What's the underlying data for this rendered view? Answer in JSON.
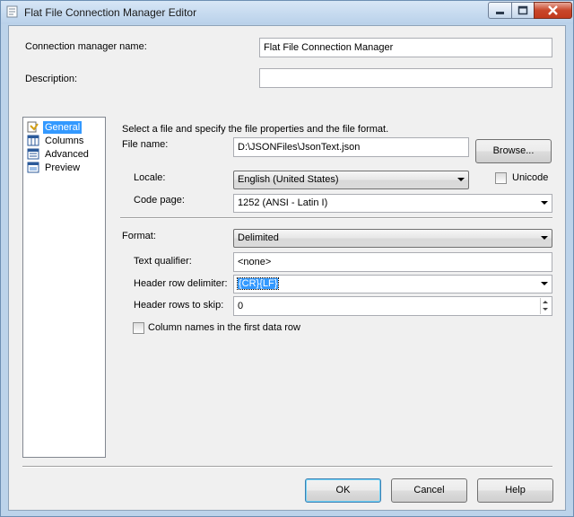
{
  "window": {
    "title": "Flat File Connection Manager Editor"
  },
  "connection_manager_name": {
    "label": "Connection manager name:",
    "value": "Flat File Connection Manager"
  },
  "description": {
    "label": "Description:",
    "value": ""
  },
  "nav": {
    "items": [
      {
        "label": "General",
        "icon": "general-icon",
        "selected": true
      },
      {
        "label": "Columns",
        "icon": "columns-icon"
      },
      {
        "label": "Advanced",
        "icon": "advanced-icon"
      },
      {
        "label": "Preview",
        "icon": "preview-icon"
      }
    ]
  },
  "general": {
    "instruction": "Select a file and specify the file properties and the file format.",
    "file_name": {
      "label": "File name:",
      "value": "D:\\JSONFiles\\JsonText.json"
    },
    "browse_label": "Browse...",
    "locale": {
      "label": "Locale:",
      "value": "English (United States)"
    },
    "unicode_label": "Unicode",
    "code_page": {
      "label": "Code page:",
      "value": "1252  (ANSI - Latin I)"
    },
    "format": {
      "label": "Format:",
      "value": "Delimited"
    },
    "text_qualifier": {
      "label": "Text qualifier:",
      "value": "<none>"
    },
    "header_row_delimiter": {
      "label": "Header row delimiter:",
      "value": "{CR}{LF}"
    },
    "header_rows_to_skip": {
      "label": "Header rows to skip:",
      "value": "0"
    },
    "column_names_label": "Column names in the first data row"
  },
  "buttons": {
    "ok": "OK",
    "cancel": "Cancel",
    "help": "Help"
  }
}
